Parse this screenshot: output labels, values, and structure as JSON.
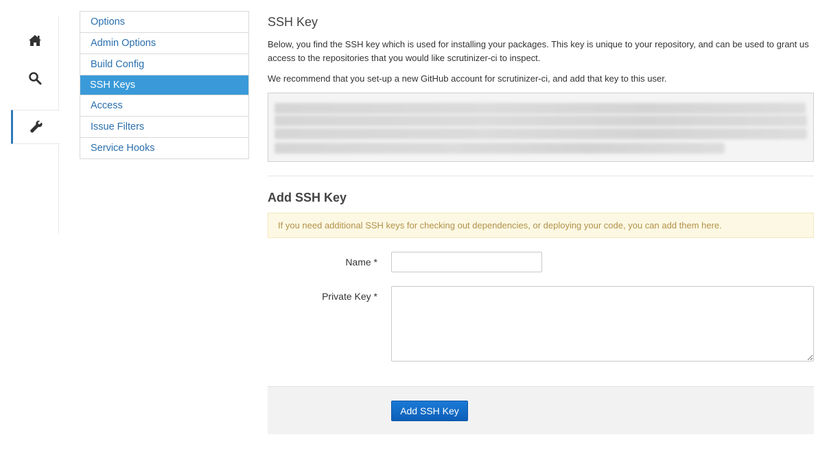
{
  "rail": {
    "items": [
      {
        "icon": "home-icon"
      },
      {
        "icon": "search-icon"
      },
      {
        "icon": "wrench-icon",
        "active": true
      }
    ]
  },
  "nav": {
    "items": [
      {
        "label": "Options"
      },
      {
        "label": "Admin Options"
      },
      {
        "label": "Build Config"
      },
      {
        "label": "SSH Keys",
        "active": true
      },
      {
        "label": "Access"
      },
      {
        "label": "Issue Filters"
      },
      {
        "label": "Service Hooks"
      }
    ]
  },
  "ssh_key": {
    "title": "SSH Key",
    "description": "Below, you find the SSH key which is used for installing your packages. This key is unique to your repository, and can be used to grant us access to the repositories that you would like scrutinizer-ci to inspect.",
    "recommendation": "We recommend that you set-up a new GitHub account for scrutinizer-ci, and add that key to this user."
  },
  "add_key": {
    "title": "Add SSH Key",
    "notice": "If you need additional SSH keys for checking out dependencies, or deploying your code, you can add them here.",
    "name_label": "Name *",
    "name_value": "",
    "private_key_label": "Private Key *",
    "private_key_value": "",
    "submit_label": "Add SSH Key"
  },
  "colors": {
    "link": "#2a6fae",
    "active_nav": "#3a9ad9",
    "accent_border": "#2f7ab8",
    "button": "#1a7ad6",
    "alert_bg": "#fcf8e3",
    "alert_text": "#b3924a"
  }
}
